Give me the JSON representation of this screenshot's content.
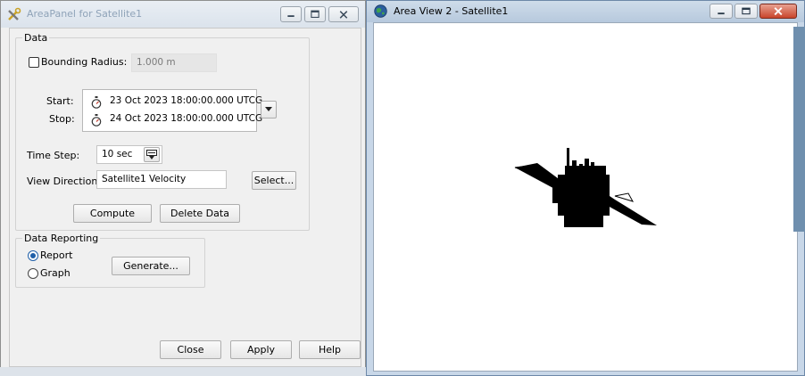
{
  "left_window": {
    "title": "AreaPanel for Satellite1",
    "data_group": {
      "label": "Data",
      "bounding_radius_label": "Bounding Radius:",
      "bounding_radius_value": "1.000 m",
      "bounding_radius_checked": false,
      "start_label": "Start:",
      "start_value": "23 Oct 2023 18:00:00.000 UTCG",
      "stop_label": "Stop:",
      "stop_value": "24 Oct 2023 18:00:00.000 UTCG",
      "time_step_label": "Time Step:",
      "time_step_value": "10 sec",
      "view_direction_label": "View Direction:",
      "view_direction_value": "Satellite1 Velocity",
      "select_button": "Select..."
    },
    "compute_button": "Compute",
    "delete_data_button": "Delete Data",
    "reporting_group": {
      "label": "Data Reporting",
      "option_report": "Report",
      "option_graph": "Graph",
      "selected": "Report",
      "generate_button": "Generate..."
    },
    "close_button": "Close",
    "apply_button": "Apply",
    "help_button": "Help"
  },
  "right_window": {
    "title": "Area View 2 - Satellite1"
  },
  "colors": {
    "window_bg": "#f0f0f0",
    "accent_radio": "#1f5fa8",
    "close_button_red": "#c9452b",
    "view_bg": "#ffffff",
    "satellite": "#000000"
  }
}
